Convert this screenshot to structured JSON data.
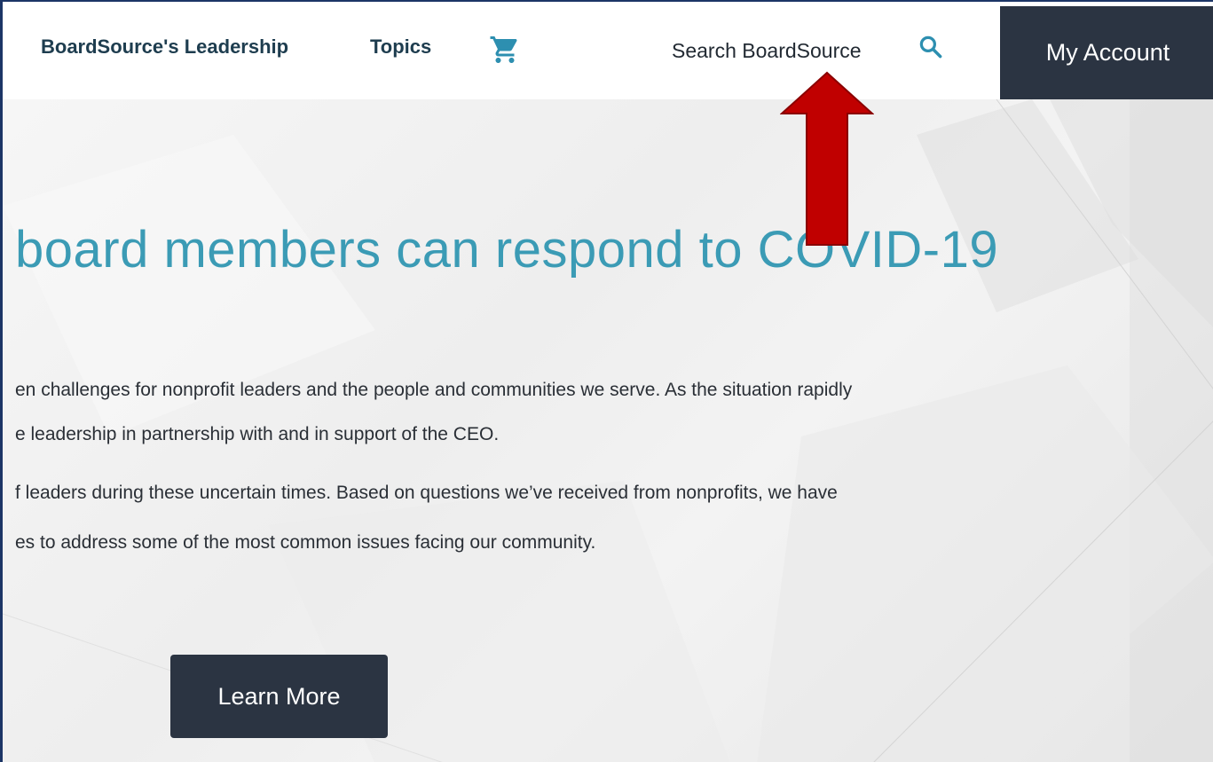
{
  "nav": {
    "leadership": "BoardSource's Leadership",
    "topics": "Topics",
    "cart_icon": "cart-icon",
    "search_label": "Search BoardSource",
    "search_icon": "search-icon",
    "account": "My Account"
  },
  "hero": {
    "title": "board members can respond to COVID-19",
    "lines": [
      "en challenges for nonprofit leaders and the people and communities we serve. As the situation rapidly",
      "e leadership in partnership with and in support of the CEO.",
      "f leaders during these uncertain times. Based on questions we’ve received from nonprofits, we have",
      "es to address some of the most common issues facing our community."
    ],
    "button": "Learn More"
  },
  "colors": {
    "accent": "#3b9bb5",
    "dark_button": "#2b3442",
    "annotation_arrow": "#c00000"
  }
}
